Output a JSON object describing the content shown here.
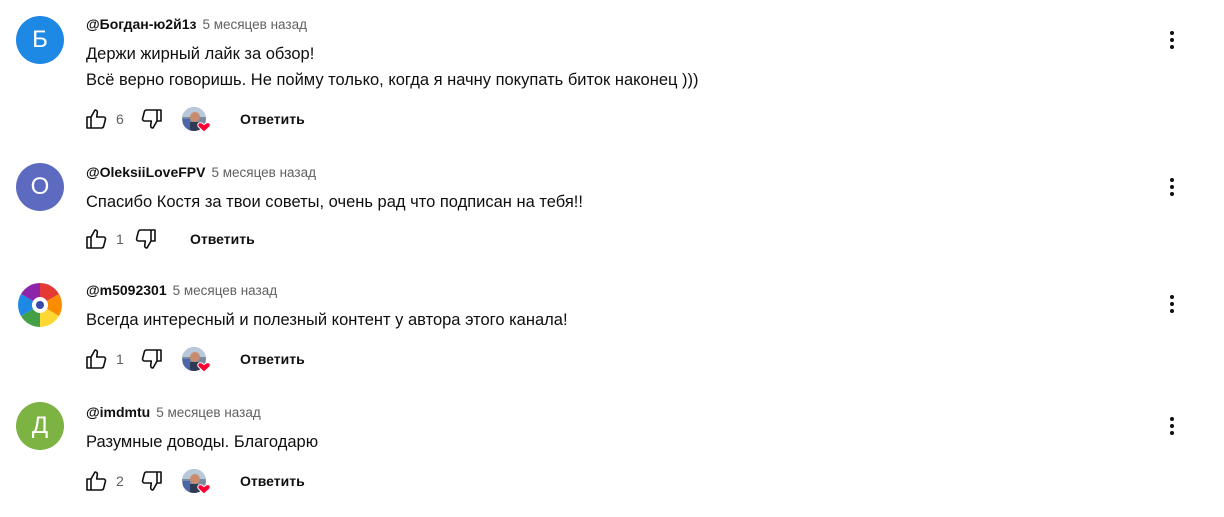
{
  "colors": {
    "avatar_b": "#1e88e5",
    "avatar_o": "#5c6bc0",
    "avatar_d": "#7cb342",
    "heart": "#ff0033"
  },
  "comments": [
    {
      "avatar_letter": "Б",
      "author": "@Богдан-ю2й1з",
      "time": "5 месяцев назад",
      "lines": [
        "Держи жирный лайк за обзор!",
        "Всё верно говоришь. Не пойму только, когда я начну покупать биток наконец )))"
      ],
      "likes": "6",
      "creator_heart": true,
      "reply_label": "Ответить"
    },
    {
      "avatar_letter": "О",
      "author": "@OleksiiLoveFPV",
      "time": "5 месяцев назад",
      "lines": [
        "Спасибо Костя за твои советы, очень рад что подписан на тебя!!"
      ],
      "likes": "1",
      "creator_heart": false,
      "reply_label": "Ответить"
    },
    {
      "avatar_letter": "",
      "author": "@m5092301",
      "time": "5 месяцев назад",
      "lines": [
        "Всегда интересный и полезный контент у автора этого канала!"
      ],
      "likes": "1",
      "creator_heart": true,
      "reply_label": "Ответить"
    },
    {
      "avatar_letter": "Д",
      "author": "@imdmtu",
      "time": "5 месяцев назад",
      "lines": [
        "Разумные доводы. Благодарю"
      ],
      "likes": "2",
      "creator_heart": true,
      "reply_label": "Ответить"
    }
  ]
}
